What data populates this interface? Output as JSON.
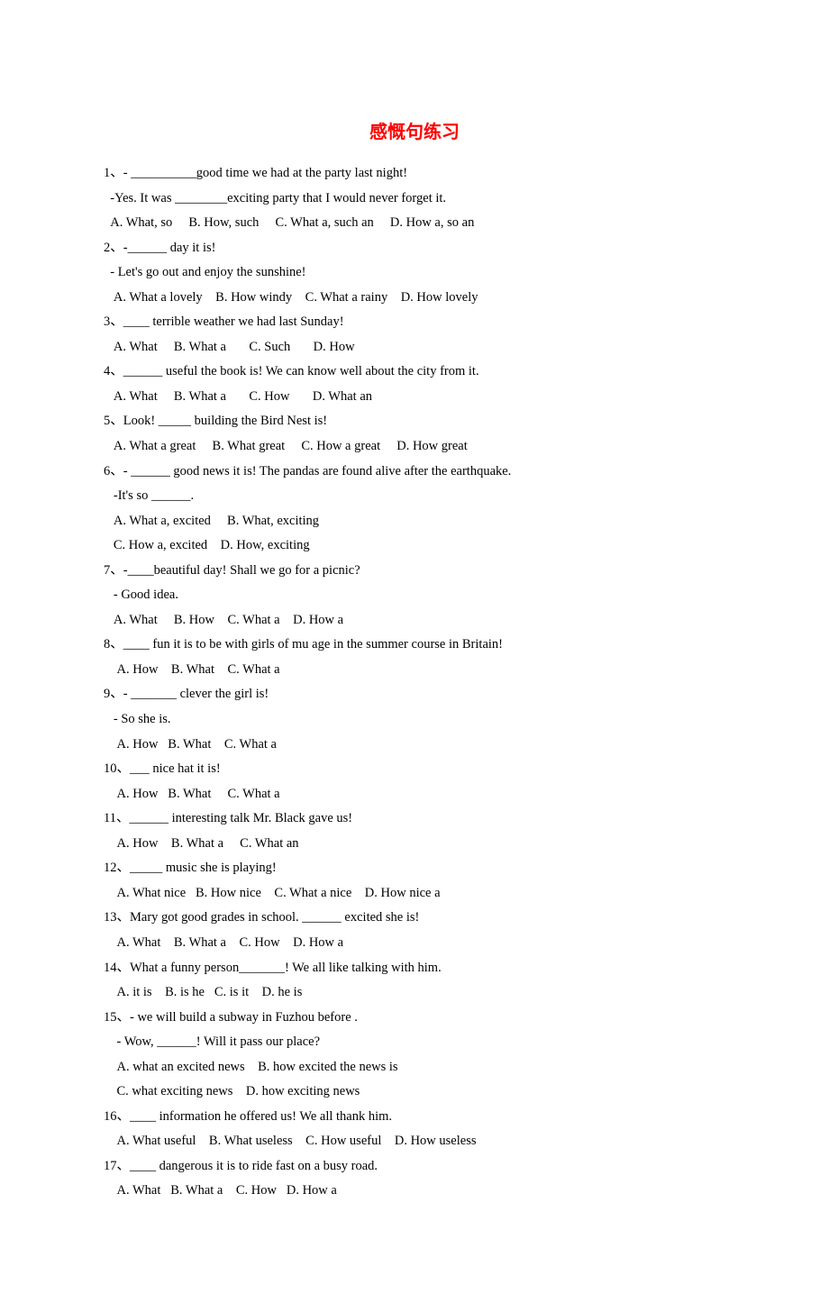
{
  "title": "感慨句练习",
  "questions": [
    {
      "num": "1",
      "lines": [
        "- __________good time we had at the party last night!",
        "-Yes. It was ________exciting party that I would never forget it.",
        "A. What, so     B. How, such     C. What a, such an     D. How a, so an"
      ]
    },
    {
      "num": "2",
      "lines": [
        "-______ day it is!",
        "- Let's go out and enjoy the sunshine!",
        " A. What a lovely    B. How windy    C. What a rainy    D. How lovely"
      ]
    },
    {
      "num": "3",
      "lines": [
        "____ terrible weather we had last Sunday!",
        " A. What     B. What a       C. Such       D. How"
      ]
    },
    {
      "num": "4",
      "lines": [
        "______ useful the book is! We can know well about the city from it.",
        " A. What     B. What a       C. How       D. What an"
      ]
    },
    {
      "num": "5",
      "lines": [
        "Look! _____ building the Bird Nest is!",
        " A. What a great     B. What great     C. How a great     D. How great"
      ]
    },
    {
      "num": "6",
      "lines": [
        "- ______ good news it is! The pandas are found alive after the earthquake.",
        " -It's so ______.",
        " A. What a, excited     B. What, exciting",
        " C. How a, excited    D. How, exciting"
      ]
    },
    {
      "num": "7",
      "lines": [
        "-____beautiful day! Shall we go for a picnic?",
        " - Good idea.",
        " A. What     B. How    C. What a    D. How a"
      ]
    },
    {
      "num": "8",
      "lines": [
        "____ fun it is to be with girls of mu age in the summer course in Britain!",
        "  A. How    B. What    C. What a"
      ]
    },
    {
      "num": "9",
      "lines": [
        "- _______ clever the girl is!",
        " - So she is.",
        "  A. How   B. What    C. What a"
      ]
    },
    {
      "num": "10",
      "lines": [
        "___ nice hat it is!",
        "  A. How   B. What     C. What a"
      ]
    },
    {
      "num": "11",
      "lines": [
        "______ interesting talk Mr. Black gave us!",
        "  A. How    B. What a     C. What an"
      ]
    },
    {
      "num": "12",
      "lines": [
        "_____ music she is playing!",
        "  A. What nice   B. How nice    C. What a nice    D. How nice a"
      ]
    },
    {
      "num": "13",
      "lines": [
        "Mary got good grades in school. ______ excited she is!",
        "  A. What    B. What a    C. How    D. How a"
      ]
    },
    {
      "num": "14",
      "lines": [
        "What a funny person_______! We all like talking with him.",
        "  A. it is    B. is he   C. is it    D. he is"
      ]
    },
    {
      "num": "15",
      "lines": [
        "- we will build a subway in Fuzhou before .",
        "  - Wow, ______! Will it pass our place?",
        "  A. what an excited news    B. how excited the news is",
        "  C. what exciting news    D. how exciting news"
      ]
    },
    {
      "num": "16",
      "lines": [
        "____ information he offered us! We all thank him.",
        "  A. What useful    B. What useless    C. How useful    D. How useless"
      ]
    },
    {
      "num": "17",
      "lines": [
        "____ dangerous it is to ride fast on a busy road.",
        "  A. What   B. What a    C. How   D. How a"
      ]
    }
  ]
}
